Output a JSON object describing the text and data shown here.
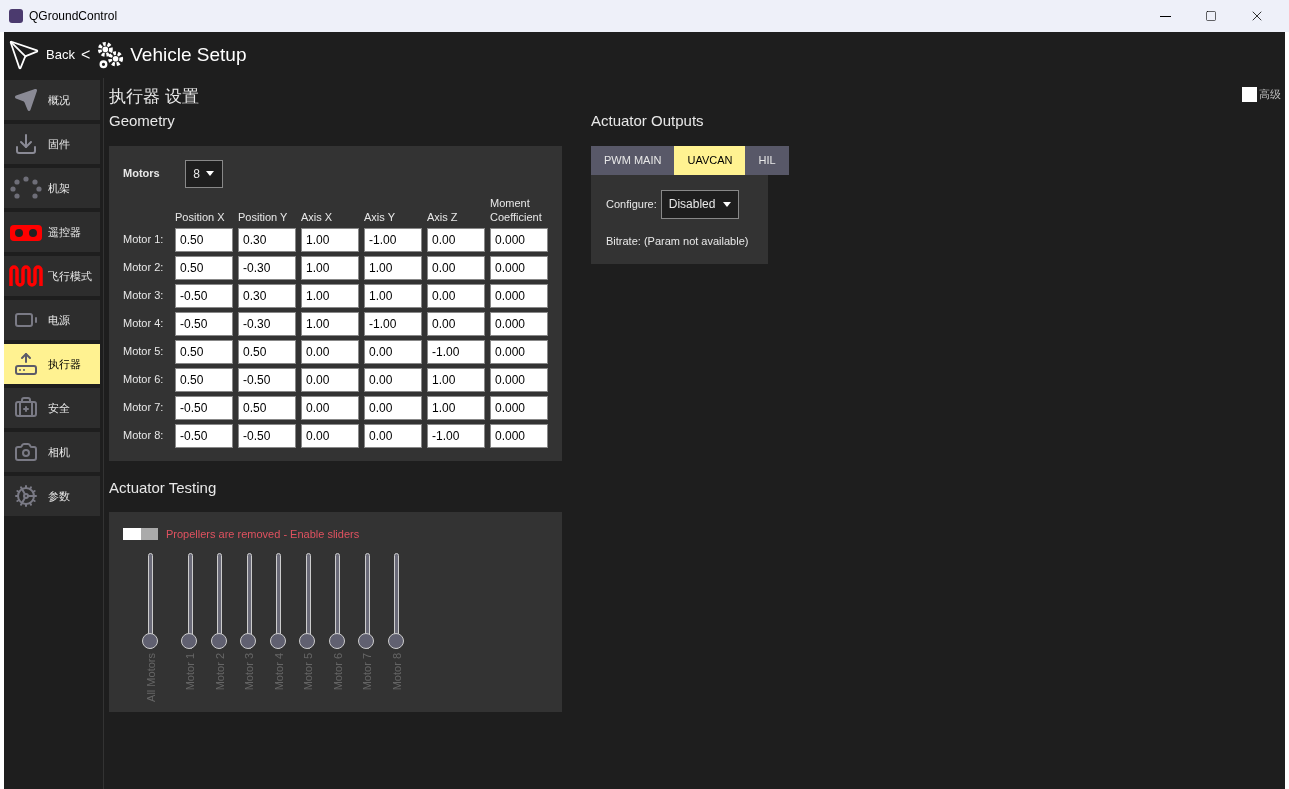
{
  "window": {
    "title": "QGroundControl"
  },
  "toolbar": {
    "back": "Back",
    "separator": "<",
    "title": "Vehicle Setup"
  },
  "sidebar": {
    "items": [
      {
        "label": "概况",
        "selected": false
      },
      {
        "label": "固件",
        "selected": false
      },
      {
        "label": "机架",
        "selected": false
      },
      {
        "label": "遥控器",
        "selected": false
      },
      {
        "label": "飞行模式",
        "selected": false
      },
      {
        "label": "电源",
        "selected": false
      },
      {
        "label": "执行器",
        "selected": true
      },
      {
        "label": "安全",
        "selected": false
      },
      {
        "label": "相机",
        "selected": false
      },
      {
        "label": "参数",
        "selected": false
      }
    ]
  },
  "page_title": "执行器 设置",
  "advanced": {
    "label": "高级",
    "checked": false
  },
  "geometry": {
    "title": "Geometry",
    "motors_label": "Motors",
    "motors_value": "8",
    "columns": [
      "Position X",
      "Position Y",
      "Axis X",
      "Axis Y",
      "Axis Z",
      "Moment Coefficient"
    ],
    "rows": [
      {
        "label": "Motor 1:",
        "values": [
          "0.50",
          "0.30",
          "1.00",
          "-1.00",
          "0.00",
          "0.000"
        ]
      },
      {
        "label": "Motor 2:",
        "values": [
          "0.50",
          "-0.30",
          "1.00",
          "1.00",
          "0.00",
          "0.000"
        ]
      },
      {
        "label": "Motor 3:",
        "values": [
          "-0.50",
          "0.30",
          "1.00",
          "1.00",
          "0.00",
          "0.000"
        ]
      },
      {
        "label": "Motor 4:",
        "values": [
          "-0.50",
          "-0.30",
          "1.00",
          "-1.00",
          "0.00",
          "0.000"
        ]
      },
      {
        "label": "Motor 5:",
        "values": [
          "0.50",
          "0.50",
          "0.00",
          "0.00",
          "-1.00",
          "0.000"
        ]
      },
      {
        "label": "Motor 6:",
        "values": [
          "0.50",
          "-0.50",
          "0.00",
          "0.00",
          "1.00",
          "0.000"
        ]
      },
      {
        "label": "Motor 7:",
        "values": [
          "-0.50",
          "0.50",
          "0.00",
          "0.00",
          "1.00",
          "0.000"
        ]
      },
      {
        "label": "Motor 8:",
        "values": [
          "-0.50",
          "-0.50",
          "0.00",
          "0.00",
          "-1.00",
          "0.000"
        ]
      }
    ]
  },
  "testing": {
    "title": "Actuator Testing",
    "switch": {
      "label": "Propellers are removed - Enable sliders",
      "on": false
    },
    "sliders": [
      {
        "label": "All Motors",
        "level": 0
      },
      {
        "label": "Motor 1",
        "level": 0
      },
      {
        "label": "Motor 2",
        "level": 0
      },
      {
        "label": "Motor 3",
        "level": 0
      },
      {
        "label": "Motor 4",
        "level": 0
      },
      {
        "label": "Motor 5",
        "level": 0
      },
      {
        "label": "Motor 6",
        "level": 0
      },
      {
        "label": "Motor 7",
        "level": 0
      },
      {
        "label": "Motor 8",
        "level": 0
      }
    ]
  },
  "outputs": {
    "title": "Actuator Outputs",
    "tabs": [
      {
        "label": "PWM MAIN",
        "selected": false
      },
      {
        "label": "UAVCAN",
        "selected": true
      },
      {
        "label": "HIL",
        "selected": false
      }
    ],
    "configure_label": "Configure:",
    "configure_value": "Disabled",
    "bitrate": "Bitrate: (Param not available)"
  }
}
